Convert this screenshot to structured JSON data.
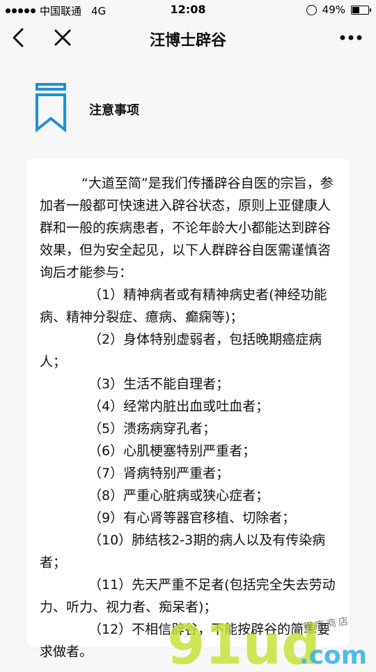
{
  "status": {
    "carrier": "中国联通",
    "network": "4G",
    "time": "12:08",
    "battery_percent": "49%",
    "battery_level": 0.49
  },
  "nav": {
    "title": "汪博士辟谷"
  },
  "section": {
    "title": "注意事项",
    "icon": "bookmark-icon",
    "accent_color": "#1e90d6"
  },
  "content": {
    "intro": "“大道至简”是我们传播辟谷自医的宗旨，参加者一般都可快速进入辟谷状态，原则上亚健康人群和一般的疾病患者，不论年龄大小都能达到辟谷效果，但为安全起见，以下人群辟谷自医需谨慎咨询后才能参与：",
    "items": [
      "（1）精神病者或有精神病史者(神经功能病、精神分裂症、癔病、癫痫等)；",
      "（2）身体特别虚弱者，包括晚期癌症病人；",
      "（3）生活不能自理者；",
      "（4）经常内脏出血或吐血者；",
      "（5）溃疡病穿孔者；",
      "（6）心肌梗塞特别严重者；",
      "（7）肾病特别严重者；",
      "（8）严重心脏病或狭心症者；",
      "（9）有心肾等器官移植、切除者；",
      "（10）肺结核2-3期的病人以及有传染病者；",
      "（11）先天严重不足者(包括完全失去劳动力、听力、视力者、痴呆者)；",
      "（12）不相信辟谷，不能按辟谷的简单要求做者。"
    ]
  },
  "watermark": {
    "logo": "91ud.com",
    "tagline": "小程序商店"
  }
}
